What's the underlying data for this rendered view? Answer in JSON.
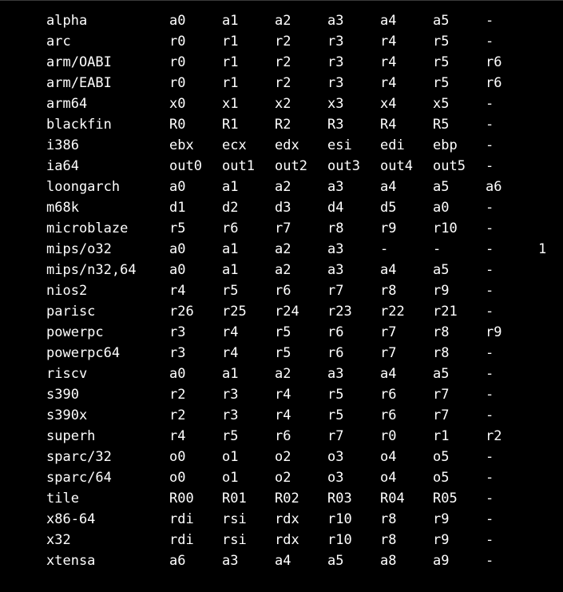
{
  "rows": [
    {
      "arch": "alpha",
      "args": [
        "a0",
        "a1",
        "a2",
        "a3",
        "a4",
        "a5",
        "-",
        ""
      ]
    },
    {
      "arch": "arc",
      "args": [
        "r0",
        "r1",
        "r2",
        "r3",
        "r4",
        "r5",
        "-",
        ""
      ]
    },
    {
      "arch": "arm/OABI",
      "args": [
        "r0",
        "r1",
        "r2",
        "r3",
        "r4",
        "r5",
        "r6",
        ""
      ]
    },
    {
      "arch": "arm/EABI",
      "args": [
        "r0",
        "r1",
        "r2",
        "r3",
        "r4",
        "r5",
        "r6",
        ""
      ]
    },
    {
      "arch": "arm64",
      "args": [
        "x0",
        "x1",
        "x2",
        "x3",
        "x4",
        "x5",
        "-",
        ""
      ]
    },
    {
      "arch": "blackfin",
      "args": [
        "R0",
        "R1",
        "R2",
        "R3",
        "R4",
        "R5",
        "-",
        ""
      ]
    },
    {
      "arch": "i386",
      "args": [
        "ebx",
        "ecx",
        "edx",
        "esi",
        "edi",
        "ebp",
        "-",
        ""
      ]
    },
    {
      "arch": "ia64",
      "args": [
        "out0",
        "out1",
        "out2",
        "out3",
        "out4",
        "out5",
        "-",
        ""
      ]
    },
    {
      "arch": "loongarch",
      "args": [
        "a0",
        "a1",
        "a2",
        "a3",
        "a4",
        "a5",
        "a6",
        ""
      ]
    },
    {
      "arch": "m68k",
      "args": [
        "d1",
        "d2",
        "d3",
        "d4",
        "d5",
        "a0",
        "-",
        ""
      ]
    },
    {
      "arch": "microblaze",
      "args": [
        "r5",
        "r6",
        "r7",
        "r8",
        "r9",
        "r10",
        "-",
        ""
      ]
    },
    {
      "arch": "mips/o32",
      "args": [
        "a0",
        "a1",
        "a2",
        "a3",
        "-",
        "-",
        "-",
        "1"
      ]
    },
    {
      "arch": "mips/n32,64",
      "args": [
        "a0",
        "a1",
        "a2",
        "a3",
        "a4",
        "a5",
        "-",
        ""
      ]
    },
    {
      "arch": "nios2",
      "args": [
        "r4",
        "r5",
        "r6",
        "r7",
        "r8",
        "r9",
        "-",
        ""
      ]
    },
    {
      "arch": "parisc",
      "args": [
        "r26",
        "r25",
        "r24",
        "r23",
        "r22",
        "r21",
        "-",
        ""
      ]
    },
    {
      "arch": "powerpc",
      "args": [
        "r3",
        "r4",
        "r5",
        "r6",
        "r7",
        "r8",
        "r9",
        ""
      ]
    },
    {
      "arch": "powerpc64",
      "args": [
        "r3",
        "r4",
        "r5",
        "r6",
        "r7",
        "r8",
        "-",
        ""
      ]
    },
    {
      "arch": "riscv",
      "args": [
        "a0",
        "a1",
        "a2",
        "a3",
        "a4",
        "a5",
        "-",
        ""
      ]
    },
    {
      "arch": "s390",
      "args": [
        "r2",
        "r3",
        "r4",
        "r5",
        "r6",
        "r7",
        "-",
        ""
      ]
    },
    {
      "arch": "s390x",
      "args": [
        "r2",
        "r3",
        "r4",
        "r5",
        "r6",
        "r7",
        "-",
        ""
      ]
    },
    {
      "arch": "superh",
      "args": [
        "r4",
        "r5",
        "r6",
        "r7",
        "r0",
        "r1",
        "r2",
        ""
      ]
    },
    {
      "arch": "sparc/32",
      "args": [
        "o0",
        "o1",
        "o2",
        "o3",
        "o4",
        "o5",
        "-",
        ""
      ]
    },
    {
      "arch": "sparc/64",
      "args": [
        "o0",
        "o1",
        "o2",
        "o3",
        "o4",
        "o5",
        "-",
        ""
      ]
    },
    {
      "arch": "tile",
      "args": [
        "R00",
        "R01",
        "R02",
        "R03",
        "R04",
        "R05",
        "-",
        ""
      ]
    },
    {
      "arch": "x86-64",
      "args": [
        "rdi",
        "rsi",
        "rdx",
        "r10",
        "r8",
        "r9",
        "-",
        ""
      ]
    },
    {
      "arch": "x32",
      "args": [
        "rdi",
        "rsi",
        "rdx",
        "r10",
        "r8",
        "r9",
        "-",
        ""
      ]
    },
    {
      "arch": "xtensa",
      "args": [
        "a6",
        "a3",
        "a4",
        "a5",
        "a8",
        "a9",
        "-",
        ""
      ]
    }
  ]
}
